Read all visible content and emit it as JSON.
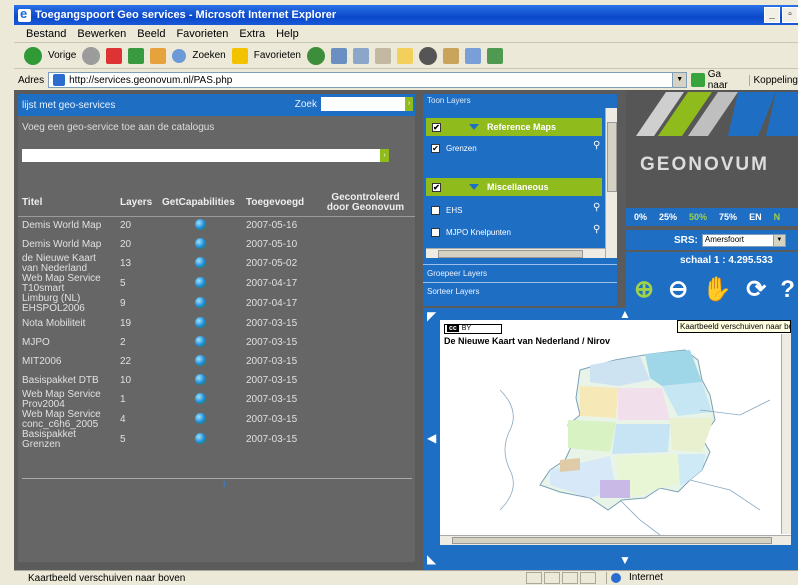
{
  "window": {
    "title": "Toegangspoort Geo services - Microsoft Internet Explorer"
  },
  "menu": [
    "Bestand",
    "Bewerken",
    "Beeld",
    "Favorieten",
    "Extra",
    "Help"
  ],
  "toolbar": {
    "back": "Vorige",
    "search": "Zoeken",
    "favorites": "Favorieten"
  },
  "address": {
    "label": "Adres",
    "url": "http://services.geonovum.nl/PAS.php",
    "go": "Ga naar",
    "links": "Koppeling"
  },
  "left": {
    "header": "lijst met geo-services",
    "search_label": "Zoek",
    "add_text": "Voeg een geo-service toe aan de catalogus",
    "columns": [
      "Titel",
      "Layers",
      "GetCapabilities",
      "Toegevoegd",
      "Gecontroleerd door Geonovum"
    ],
    "rows": [
      {
        "title": "Demis World Map",
        "layers": "20",
        "date": "2007-05-16"
      },
      {
        "title": "Demis World Map",
        "layers": "20",
        "date": "2007-05-10"
      },
      {
        "title": "de Nieuwe Kaart van Nederland",
        "layers": "13",
        "date": "2007-05-02"
      },
      {
        "title": "Web Map Service T10smart",
        "layers": "5",
        "date": "2007-04-17"
      },
      {
        "title": "Limburg (NL) EHSPOL2006",
        "layers": "9",
        "date": "2007-04-17"
      },
      {
        "title": "Nota Mobiliteit",
        "layers": "19",
        "date": "2007-03-15"
      },
      {
        "title": "MJPO",
        "layers": "2",
        "date": "2007-03-15"
      },
      {
        "title": "MIT2006",
        "layers": "22",
        "date": "2007-03-15"
      },
      {
        "title": "Basispakket DTB",
        "layers": "10",
        "date": "2007-03-15"
      },
      {
        "title": "Web Map Service Prov2004",
        "layers": "1",
        "date": "2007-03-15"
      },
      {
        "title": "Web Map Service conc_c6h6_2005",
        "layers": "4",
        "date": "2007-03-15"
      },
      {
        "title": "Basispakket Grenzen",
        "layers": "5",
        "date": "2007-03-15"
      }
    ]
  },
  "layers": {
    "header": "Toon Layers",
    "group1": "Reference Maps",
    "item1": "Grenzen",
    "group2": "Miscellaneous",
    "item2": "EHS",
    "item3": "MJPO Knelpunten",
    "link1": "Groepeer Layers",
    "link2": "Sorteer Layers"
  },
  "logo": {
    "name": "GEONOVUM"
  },
  "zoom": [
    "0%",
    "25%",
    "50%",
    "75%",
    "EN",
    "N"
  ],
  "srs": {
    "label": "SRS:",
    "value": "Amersfoort"
  },
  "scale": "schaal 1 : 4.295.533",
  "map": {
    "license": "BY",
    "title": "De Nieuwe Kaart van Nederland / Nirov",
    "tooltip": "Kaartbeeld verschuiven naar boven"
  },
  "status": {
    "text": "Kaartbeeld verschuiven naar boven",
    "zone": "Internet"
  },
  "colors": {
    "panel_blue": "#1e6ec3",
    "accent_green": "#8fbc1c",
    "background_gray": "#5b5b5b"
  }
}
